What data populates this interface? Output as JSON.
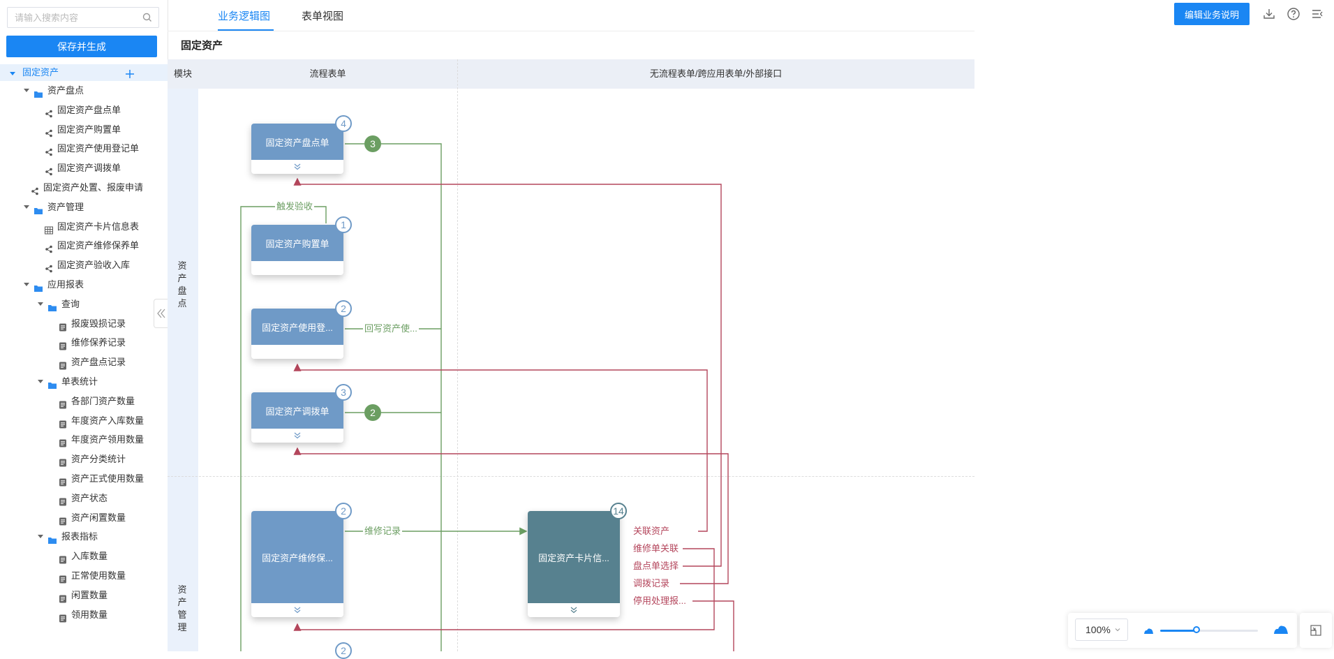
{
  "sidebar": {
    "search_placeholder": "请输入搜索内容",
    "save_button": "保存并生成",
    "tree": [
      {
        "label": "固定资产",
        "level": 0,
        "type": "root",
        "expanded": true,
        "active": true
      },
      {
        "label": "资产盘点",
        "level": 1,
        "type": "folder",
        "expanded": true
      },
      {
        "label": "固定资产盘点单",
        "level": 2,
        "type": "flow"
      },
      {
        "label": "固定资产购置单",
        "level": 2,
        "type": "flow"
      },
      {
        "label": "固定资产使用登记单",
        "level": 2,
        "type": "flow"
      },
      {
        "label": "固定资产调拨单",
        "level": 2,
        "type": "flow"
      },
      {
        "label": "固定资产处置、报废申请",
        "level": 1,
        "type": "flow"
      },
      {
        "label": "资产管理",
        "level": 1,
        "type": "folder",
        "expanded": true
      },
      {
        "label": "固定资产卡片信息表",
        "level": 2,
        "type": "table"
      },
      {
        "label": "固定资产维修保养单",
        "level": 2,
        "type": "flow"
      },
      {
        "label": "固定资产验收入库",
        "level": 2,
        "type": "flow"
      },
      {
        "label": "应用报表",
        "level": 1,
        "type": "folder",
        "expanded": true
      },
      {
        "label": "查询",
        "level": 2,
        "type": "folder",
        "expanded": true
      },
      {
        "label": "报废毁损记录",
        "level": 3,
        "type": "report"
      },
      {
        "label": "维修保养记录",
        "level": 3,
        "type": "report"
      },
      {
        "label": "资产盘点记录",
        "level": 3,
        "type": "report"
      },
      {
        "label": "单表统计",
        "level": 2,
        "type": "folder",
        "expanded": true
      },
      {
        "label": "各部门资产数量",
        "level": 3,
        "type": "report"
      },
      {
        "label": "年度资产入库数量",
        "level": 3,
        "type": "report"
      },
      {
        "label": "年度资产领用数量",
        "level": 3,
        "type": "report"
      },
      {
        "label": "资产分类统计",
        "level": 3,
        "type": "report"
      },
      {
        "label": "资产正式使用数量",
        "level": 3,
        "type": "report"
      },
      {
        "label": "资产状态",
        "level": 3,
        "type": "report"
      },
      {
        "label": "资产闲置数量",
        "level": 3,
        "type": "report"
      },
      {
        "label": "报表指标",
        "level": 2,
        "type": "folder",
        "expanded": true
      },
      {
        "label": "入库数量",
        "level": 3,
        "type": "report"
      },
      {
        "label": "正常使用数量",
        "level": 3,
        "type": "report"
      },
      {
        "label": "闲置数量",
        "level": 3,
        "type": "report"
      },
      {
        "label": "领用数量",
        "level": 3,
        "type": "report"
      }
    ]
  },
  "header": {
    "tabs": [
      "业务逻辑图",
      "表单视图"
    ],
    "active_tab": 0,
    "edit_button": "编辑业务说明"
  },
  "page_title": "固定资产",
  "canvas": {
    "columns": [
      "模块",
      "流程表单",
      "无流程表单/跨应用表单/外部接口"
    ],
    "lanes": [
      "资产盘点",
      "资产管理"
    ],
    "cards": [
      {
        "label": "固定资产盘点单",
        "badge": "4"
      },
      {
        "label": "固定资产购置单",
        "badge": "1"
      },
      {
        "label": "固定资产使用登...",
        "badge": "2"
      },
      {
        "label": "固定资产调拨单",
        "badge": "3"
      },
      {
        "label": "固定资产维修保...",
        "badge": "2"
      },
      {
        "label": "固定资产卡片信...",
        "badge": "14"
      },
      {
        "label": "",
        "badge": "2"
      }
    ],
    "green_badges": [
      "3",
      "2"
    ],
    "green_labels": [
      "触发验收",
      "回写资产使...",
      "维修记录"
    ],
    "red_labels": [
      "关联资产",
      "维修单关联",
      "盘点单选择",
      "调拨记录",
      "停用处理报..."
    ]
  },
  "zoom": {
    "level": "100%",
    "slider": 0.37
  },
  "colors": {
    "accent": "#1a86f3",
    "card": "#6f9ac7",
    "card_teal": "#57818f",
    "green": "#6b9e62",
    "red": "#b4465c"
  }
}
